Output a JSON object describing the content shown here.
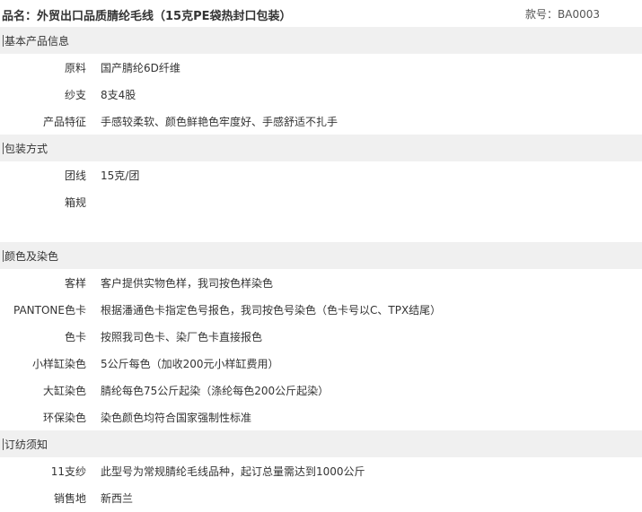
{
  "header": {
    "title": "品名：外贸出口品质腈纶毛线（15克PE袋热封口包装）",
    "code": "款号：BA0003"
  },
  "sections": [
    {
      "heading": "基本产品信息",
      "rows": [
        {
          "label": "原料",
          "value": "国产腈纶6D纤维"
        },
        {
          "label": "纱支",
          "value": "8支4股"
        },
        {
          "label": "产品特征",
          "value": "手感较柔软、颜色鲜艳色牢度好、手感舒适不扎手"
        }
      ]
    },
    {
      "heading": "包装方式",
      "rows": [
        {
          "label": "团线",
          "value": "15克/团"
        },
        {
          "label": "箱规",
          "value": ""
        }
      ]
    },
    {
      "heading": "颜色及染色",
      "rows": [
        {
          "label": "客样",
          "value": "客户提供实物色样，我司按色样染色"
        },
        {
          "label": "PANTONE色卡",
          "value": "根据潘通色卡指定色号报色，我司按色号染色（色卡号以C、TPX结尾）"
        },
        {
          "label": "色卡",
          "value": "按照我司色卡、染厂色卡直接报色"
        },
        {
          "label": "小样缸染色",
          "value": "5公斤每色（加收200元小样缸费用）"
        },
        {
          "label": "大缸染色",
          "value": "腈纶每色75公斤起染（涤纶每色200公斤起染）"
        },
        {
          "label": "环保染色",
          "value": "染色颜色均符合国家强制性标准"
        }
      ]
    },
    {
      "heading": "订纺须知",
      "rows": [
        {
          "label": "11支纱",
          "value": "此型号为常规腈纶毛线品种，起订总量需达到1000公斤"
        },
        {
          "label": "销售地",
          "value": "新西兰"
        }
      ]
    }
  ]
}
